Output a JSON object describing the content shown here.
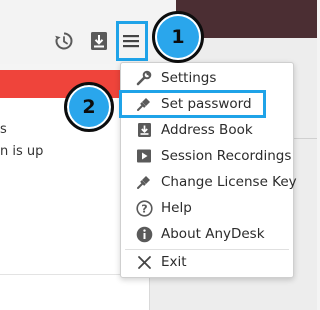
{
  "toolbar": {
    "icons": [
      "history-icon",
      "install-icon",
      "hamburger-menu-icon"
    ]
  },
  "left_panel": {
    "line1": "s",
    "line2": "n is up"
  },
  "menu": {
    "items": [
      {
        "label": "Settings",
        "icon": "wrench-icon"
      },
      {
        "label": "Set password",
        "icon": "pin-icon"
      },
      {
        "label": "Address Book",
        "icon": "address-book-icon"
      },
      {
        "label": "Session Recordings",
        "icon": "play-recording-icon"
      },
      {
        "label": "Change License Key",
        "icon": "pin-icon"
      },
      {
        "label": "Help",
        "icon": "help-icon"
      },
      {
        "label": "About AnyDesk",
        "icon": "info-icon"
      },
      {
        "label": "Exit",
        "icon": "close-icon"
      }
    ]
  },
  "callouts": {
    "first": "1",
    "second": "2"
  },
  "colors": {
    "highlight": "#1fa3e8",
    "callout_fill": "#2aa6ec",
    "red_bar": "#ef443b",
    "title_band": "#4b2e33",
    "icon_gray": "#5a5a5a"
  }
}
